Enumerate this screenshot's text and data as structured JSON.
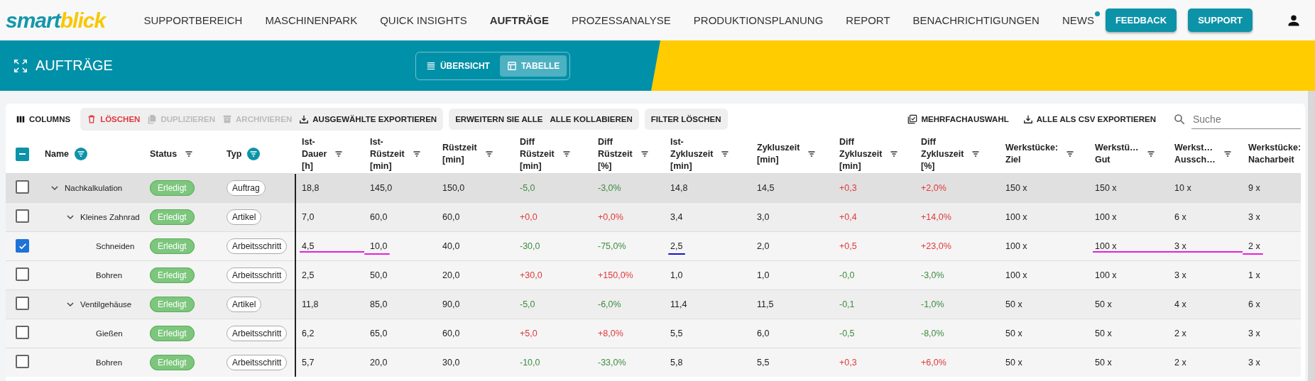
{
  "logo": [
    "smart",
    "blick"
  ],
  "nav": [
    {
      "label": "SUPPORTBEREICH",
      "selected": false,
      "badge": false
    },
    {
      "label": "MASCHINENPARK",
      "selected": false,
      "badge": false
    },
    {
      "label": "QUICK INSIGHTS",
      "selected": false,
      "badge": false
    },
    {
      "label": "AUFTRÄGE",
      "selected": true,
      "badge": false
    },
    {
      "label": "PROZESSANALYSE",
      "selected": false,
      "badge": false
    },
    {
      "label": "PRODUKTIONSPLANUNG",
      "selected": false,
      "badge": false
    },
    {
      "label": "REPORT",
      "selected": false,
      "badge": false
    },
    {
      "label": "BENACHRICHTIGUNGEN",
      "selected": false,
      "badge": false
    },
    {
      "label": "NEWS",
      "selected": false,
      "badge": true
    }
  ],
  "header_buttons": [
    "FEEDBACK",
    "SUPPORT"
  ],
  "page_title": "AUFTRÄGE",
  "views": [
    {
      "label": "ÜBERSICHT",
      "kind": "list",
      "selected": false
    },
    {
      "label": "TABELLE",
      "kind": "table",
      "selected": true
    }
  ],
  "toolbar": {
    "columns": "COLUMNS",
    "actions": [
      {
        "label": "LÖSCHEN",
        "kind": "delete",
        "disabled": false
      },
      {
        "label": "DUPLIZIEREN",
        "kind": "copy",
        "disabled": true
      },
      {
        "label": "ARCHIVIEREN",
        "kind": "archive",
        "disabled": true
      },
      {
        "label": "AUSGEWÄHLTE EXPORTIEREN",
        "kind": "export",
        "disabled": false
      }
    ],
    "tree_actions": [
      "ERWEITERN SIE ALLE",
      "ALLE KOLLABIEREN"
    ],
    "filter_reset": "FILTER LÖSCHEN",
    "right_actions": [
      {
        "label": "MEHRFACHAUSWAHL",
        "kind": "multiselect"
      },
      {
        "label": "ALLE ALS CSV EXPORTIEREN",
        "kind": "export"
      }
    ],
    "search": {
      "placeholder": "Suche"
    }
  },
  "table": {
    "select_all": {
      "indeterminate": true
    },
    "fixed_columns": [
      {
        "label": "Name",
        "filter_active": true
      },
      {
        "label": "Status",
        "filter_active": false
      },
      {
        "label": "Typ",
        "filter_active": true
      }
    ],
    "columns": [
      "Ist-Dauer [h]",
      "Ist-Rüstzeit [min]",
      "Rüstzeit [min]",
      "Diff Rüstzeit [min]",
      "Diff Rüstzeit [%]",
      "Ist-Zykluszeit [min]",
      "Zykluszeit [min]",
      "Diff Zykluszeit [min]",
      "Diff Zykluszeit [%]",
      "Werkstücke: Ziel",
      "Werkstü… Gut",
      "Werkst… Aussch…",
      "Werkstücke: Nacharbeit"
    ],
    "rows": [
      {
        "name": "Nachkalkulation",
        "status": "Erledigt",
        "type": "Auftrag",
        "checked": false,
        "expanded": true,
        "cells": [
          {
            "text": "18,8"
          },
          {
            "text": "145,0"
          },
          {
            "text": "150,0"
          },
          {
            "text": "-5,0",
            "color": "#3c8c40"
          },
          {
            "text": "-3,0%",
            "color": "#3c8c40"
          },
          {
            "text": "14,8"
          },
          {
            "text": "14,5"
          },
          {
            "text": "+0,3",
            "color": "#e0383a"
          },
          {
            "text": "+2,0%",
            "color": "#e0383a"
          },
          {
            "text": "150 x"
          },
          {
            "text": "150 x"
          },
          {
            "text": "10 x"
          },
          {
            "text": "9 x"
          }
        ],
        "children": [
          {
            "name": "Kleines Zahnrad",
            "status": "Erledigt",
            "type": "Artikel",
            "checked": false,
            "expanded": true,
            "cells": [
              {
                "text": "7,0"
              },
              {
                "text": "60,0"
              },
              {
                "text": "60,0"
              },
              {
                "text": "+0,0",
                "color": "#e0383a"
              },
              {
                "text": "+0,0%",
                "color": "#e0383a"
              },
              {
                "text": "3,4"
              },
              {
                "text": "3,0"
              },
              {
                "text": "+0,4",
                "color": "#e0383a"
              },
              {
                "text": "+14,0%",
                "color": "#e0383a"
              },
              {
                "text": "100 x"
              },
              {
                "text": "100 x"
              },
              {
                "text": "6 x"
              },
              {
                "text": "3 x"
              }
            ],
            "children": [
              {
                "name": "Schneiden",
                "status": "Erledigt",
                "type": "Arbeitsschritt",
                "checked": true,
                "cells": [
                  {
                    "text": "4,5",
                    "underline": {
                      "color": "#e81ee0"
                    }
                  },
                  {
                    "text": "10,0",
                    "underline": {
                      "color": "#e81ee0"
                    }
                  },
                  {
                    "text": "40,0"
                  },
                  {
                    "text": "-30,0",
                    "color": "#3c8c40"
                  },
                  {
                    "text": "-75,0%",
                    "color": "#3c8c40"
                  },
                  {
                    "text": "2,5",
                    "underline": {
                      "color": "#1414c8"
                    }
                  },
                  {
                    "text": "2,0"
                  },
                  {
                    "text": "+0,5",
                    "color": "#e0383a"
                  },
                  {
                    "text": "+23,0%",
                    "color": "#e0383a"
                  },
                  {
                    "text": "100 x"
                  },
                  {
                    "text": "100 x",
                    "underline": {
                      "color": "#e81ee0"
                    }
                  },
                  {
                    "text": "3 x",
                    "underline": {
                      "color": "#e81ee0"
                    }
                  },
                  {
                    "text": "2 x",
                    "underline": {
                      "color": "#e81ee0"
                    }
                  }
                ]
              },
              {
                "name": "Bohren",
                "status": "Erledigt",
                "type": "Arbeitsschritt",
                "checked": false,
                "cells": [
                  {
                    "text": "2,5"
                  },
                  {
                    "text": "50,0"
                  },
                  {
                    "text": "20,0"
                  },
                  {
                    "text": "+30,0",
                    "color": "#e0383a"
                  },
                  {
                    "text": "+150,0%",
                    "color": "#e0383a"
                  },
                  {
                    "text": "1,0"
                  },
                  {
                    "text": "1,0"
                  },
                  {
                    "text": "-0,0",
                    "color": "#3c8c40"
                  },
                  {
                    "text": "-3,0%",
                    "color": "#3c8c40"
                  },
                  {
                    "text": "100 x"
                  },
                  {
                    "text": "100 x"
                  },
                  {
                    "text": "3 x"
                  },
                  {
                    "text": "1 x"
                  }
                ]
              }
            ]
          },
          {
            "name": "Ventilgehäuse",
            "status": "Erledigt",
            "type": "Artikel",
            "checked": false,
            "expanded": true,
            "cells": [
              {
                "text": "11,8"
              },
              {
                "text": "85,0"
              },
              {
                "text": "90,0"
              },
              {
                "text": "-5,0",
                "color": "#3c8c40"
              },
              {
                "text": "-6,0%",
                "color": "#3c8c40"
              },
              {
                "text": "11,4"
              },
              {
                "text": "11,5"
              },
              {
                "text": "-0,1",
                "color": "#3c8c40"
              },
              {
                "text": "-1,0%",
                "color": "#3c8c40"
              },
              {
                "text": "50 x"
              },
              {
                "text": "50 x"
              },
              {
                "text": "4 x"
              },
              {
                "text": "6 x"
              }
            ],
            "children": [
              {
                "name": "Gießen",
                "status": "Erledigt",
                "type": "Arbeitsschritt",
                "checked": false,
                "cells": [
                  {
                    "text": "6,2"
                  },
                  {
                    "text": "65,0"
                  },
                  {
                    "text": "60,0"
                  },
                  {
                    "text": "+5,0",
                    "color": "#e0383a"
                  },
                  {
                    "text": "+8,0%",
                    "color": "#e0383a"
                  },
                  {
                    "text": "5,5"
                  },
                  {
                    "text": "6,0"
                  },
                  {
                    "text": "-0,5",
                    "color": "#3c8c40"
                  },
                  {
                    "text": "-8,0%",
                    "color": "#3c8c40"
                  },
                  {
                    "text": "50 x"
                  },
                  {
                    "text": "50 x"
                  },
                  {
                    "text": "2 x"
                  },
                  {
                    "text": "3 x"
                  }
                ]
              },
              {
                "name": "Bohren",
                "status": "Erledigt",
                "type": "Arbeitsschritt",
                "checked": false,
                "cells": [
                  {
                    "text": "5,7"
                  },
                  {
                    "text": "20,0"
                  },
                  {
                    "text": "30,0"
                  },
                  {
                    "text": "-10,0",
                    "color": "#3c8c40"
                  },
                  {
                    "text": "-33,0%",
                    "color": "#3c8c40"
                  },
                  {
                    "text": "5,8"
                  },
                  {
                    "text": "5,5"
                  },
                  {
                    "text": "+0,3",
                    "color": "#e0383a"
                  },
                  {
                    "text": "+6,0%",
                    "color": "#e0383a"
                  },
                  {
                    "text": "50 x"
                  },
                  {
                    "text": "50 x"
                  },
                  {
                    "text": "2 x"
                  },
                  {
                    "text": "3 x"
                  }
                ]
              }
            ]
          }
        ]
      }
    ]
  }
}
